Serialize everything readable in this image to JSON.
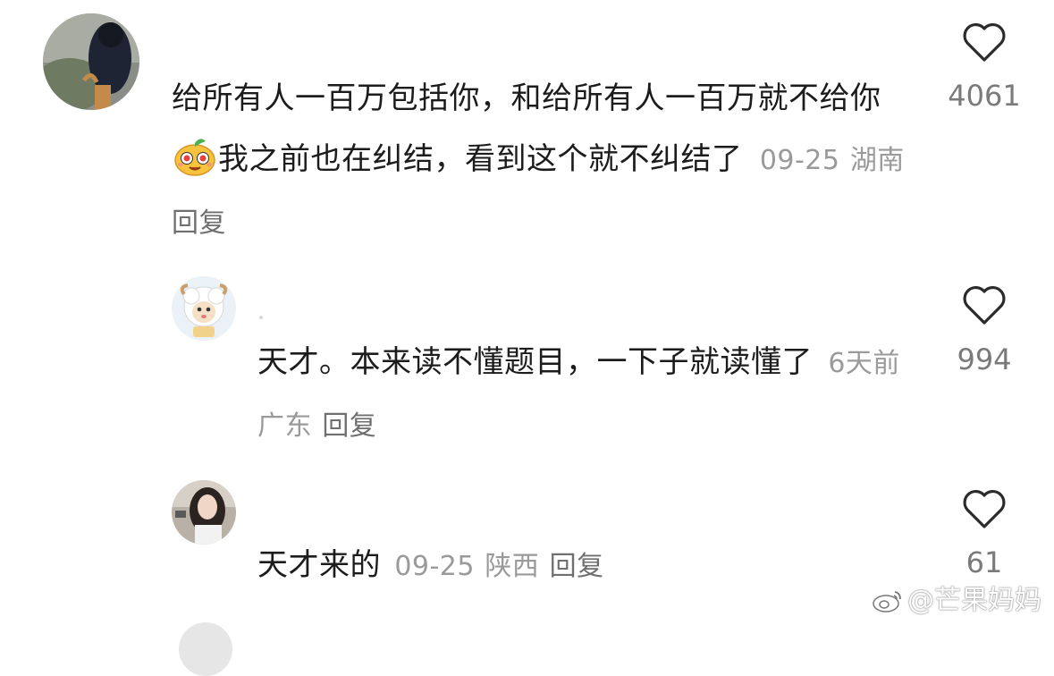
{
  "comments": [
    {
      "text_before_emoji": "给所有人一百万包括你，和给所有人一百万就不给你",
      "text_after_emoji": "我之前也在纠结，看到这个就不纠结了",
      "emoji": "smiling-character-emoji",
      "date": "09-25",
      "location": "湖南",
      "reply_label": "回复",
      "likes": "4061"
    },
    {
      "text": "天才。本来读不懂题目，一下子就读懂了",
      "date": "6天前",
      "location": "广东",
      "reply_label": "回复",
      "likes": "994"
    },
    {
      "text": "天才来的",
      "date": "09-25",
      "location": "陕西",
      "reply_label": "回复",
      "likes": "61"
    }
  ],
  "watermark": {
    "text": "@芒果妈妈",
    "icon": "weibo-logo-icon"
  },
  "icons": {
    "like": "heart-outline-icon",
    "colors": {
      "icon_stroke": "#2b2b2b",
      "meta_gray": "#9a9a9a",
      "reply_gray": "#6f6f6f"
    }
  }
}
